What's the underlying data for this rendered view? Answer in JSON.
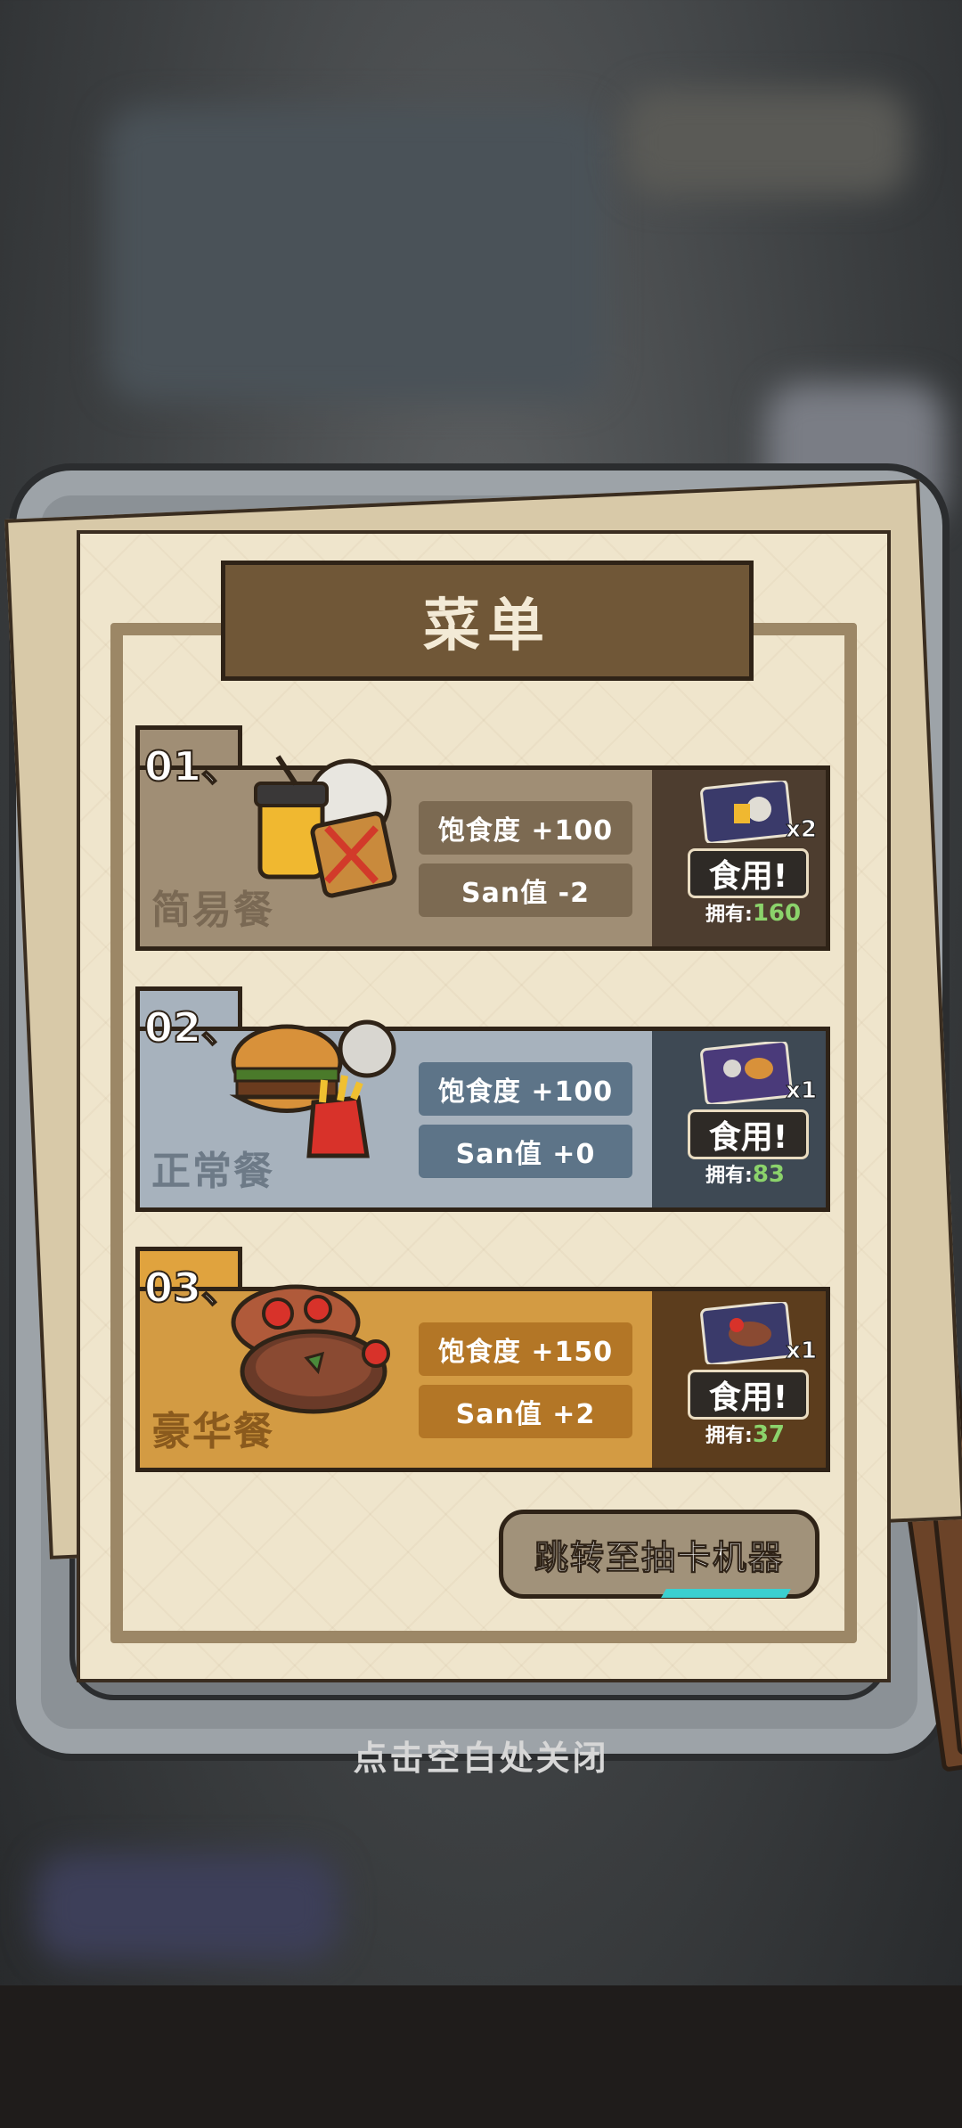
{
  "menu": {
    "title": "菜单",
    "meals": [
      {
        "number": "01、",
        "name": "简易餐",
        "satiety": "饱食度 +100",
        "san": "San值 -2",
        "card_qty": "x2",
        "eat_label": "食用!",
        "owned_label": "拥有:",
        "owned_value": "160",
        "colors": {
          "main": "#a08e75",
          "tab": "#a08e75",
          "stat": "#7c6a52",
          "panel": "#4d3d2f",
          "name": "#7a6954"
        }
      },
      {
        "number": "02、",
        "name": "正常餐",
        "satiety": "饱食度 +100",
        "san": "San值 +0",
        "card_qty": "x1",
        "eat_label": "食用!",
        "owned_label": "拥有:",
        "owned_value": "83",
        "colors": {
          "main": "#a7b2bd",
          "tab": "#a7b2bd",
          "stat": "#5d7488",
          "panel": "#3e4954",
          "name": "#6d7a87"
        }
      },
      {
        "number": "03、",
        "name": "豪华餐",
        "satiety": "饱食度 +150",
        "san": "San值 +2",
        "card_qty": "x1",
        "eat_label": "食用!",
        "owned_label": "拥有:",
        "owned_value": "37",
        "colors": {
          "main": "#d39b43",
          "tab": "#e0a33e",
          "stat": "#b37626",
          "panel": "#5c3d1d",
          "name": "#8a5a1d"
        }
      }
    ],
    "jump_button": "跳转至抽卡机器"
  },
  "close_hint": "点击空白处关闭"
}
